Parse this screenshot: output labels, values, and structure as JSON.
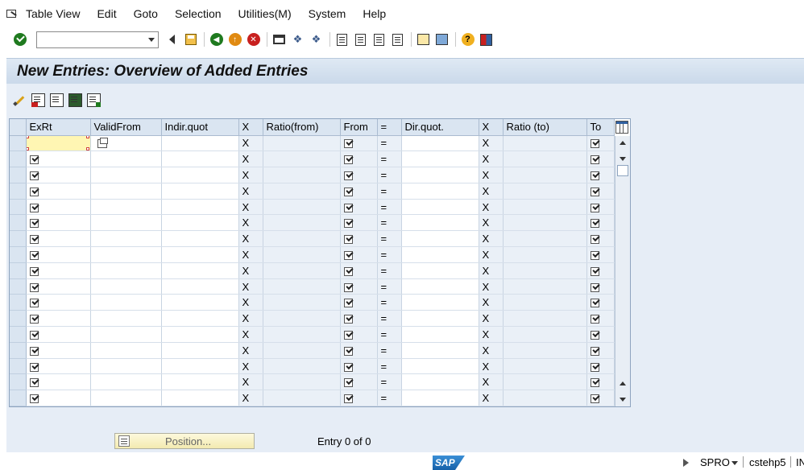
{
  "menubar": {
    "items": [
      "Table View",
      "Edit",
      "Goto",
      "Selection",
      "Utilities(M)",
      "System",
      "Help"
    ]
  },
  "toolbar": {
    "command_value": ""
  },
  "title": "New Entries: Overview of Added Entries",
  "grid": {
    "columns": [
      "ExRt",
      "ValidFrom",
      "Indir.quot",
      "X",
      "Ratio(from)",
      "From",
      "=",
      "Dir.quot.",
      "X",
      "Ratio (to)",
      "To"
    ],
    "x_label": "X",
    "eq_label": "=",
    "row_count": 17
  },
  "bottom": {
    "position_label": "Position...",
    "entry_text": "Entry 0 of 0"
  },
  "status": {
    "logo": "SAP",
    "transaction": "SPRO",
    "system": "cstehp5",
    "mode": "IN"
  },
  "colors": {
    "header_bg": "#dae5f1",
    "content_bg": "#e6edf6",
    "cursor_cell": "#fff6b3"
  }
}
